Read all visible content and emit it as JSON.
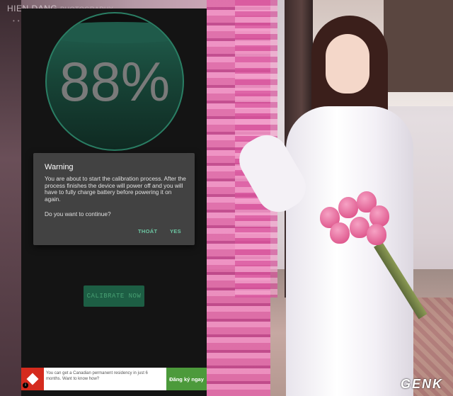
{
  "watermark": {
    "text": "HIEN DANG",
    "sub": "PHOTOGRAPHY"
  },
  "brand_watermark": "GENK",
  "gauge": {
    "percent": "88%",
    "level": 0.88
  },
  "dialog": {
    "title": "Warning",
    "message": "You are about to start the calibration process. After the process finishes the device will power off and you will have to fully charge battery before powering it on again.",
    "question": "Do you want to continue?",
    "buttons": {
      "negative": "THOÁT",
      "positive": "YES"
    }
  },
  "calibrate_button": "CALIBRATE NOW",
  "ad": {
    "text": "You can get a Canadian permanent residency in just 6 months. Want to know how?",
    "cta": "Đăng ký ngay",
    "info_icon": "i"
  },
  "colors": {
    "accent": "#6dc7a3",
    "gauge_fill": "#1f5a4a",
    "dialog_bg": "#424242",
    "ad_cta": "#4c9a3b"
  }
}
